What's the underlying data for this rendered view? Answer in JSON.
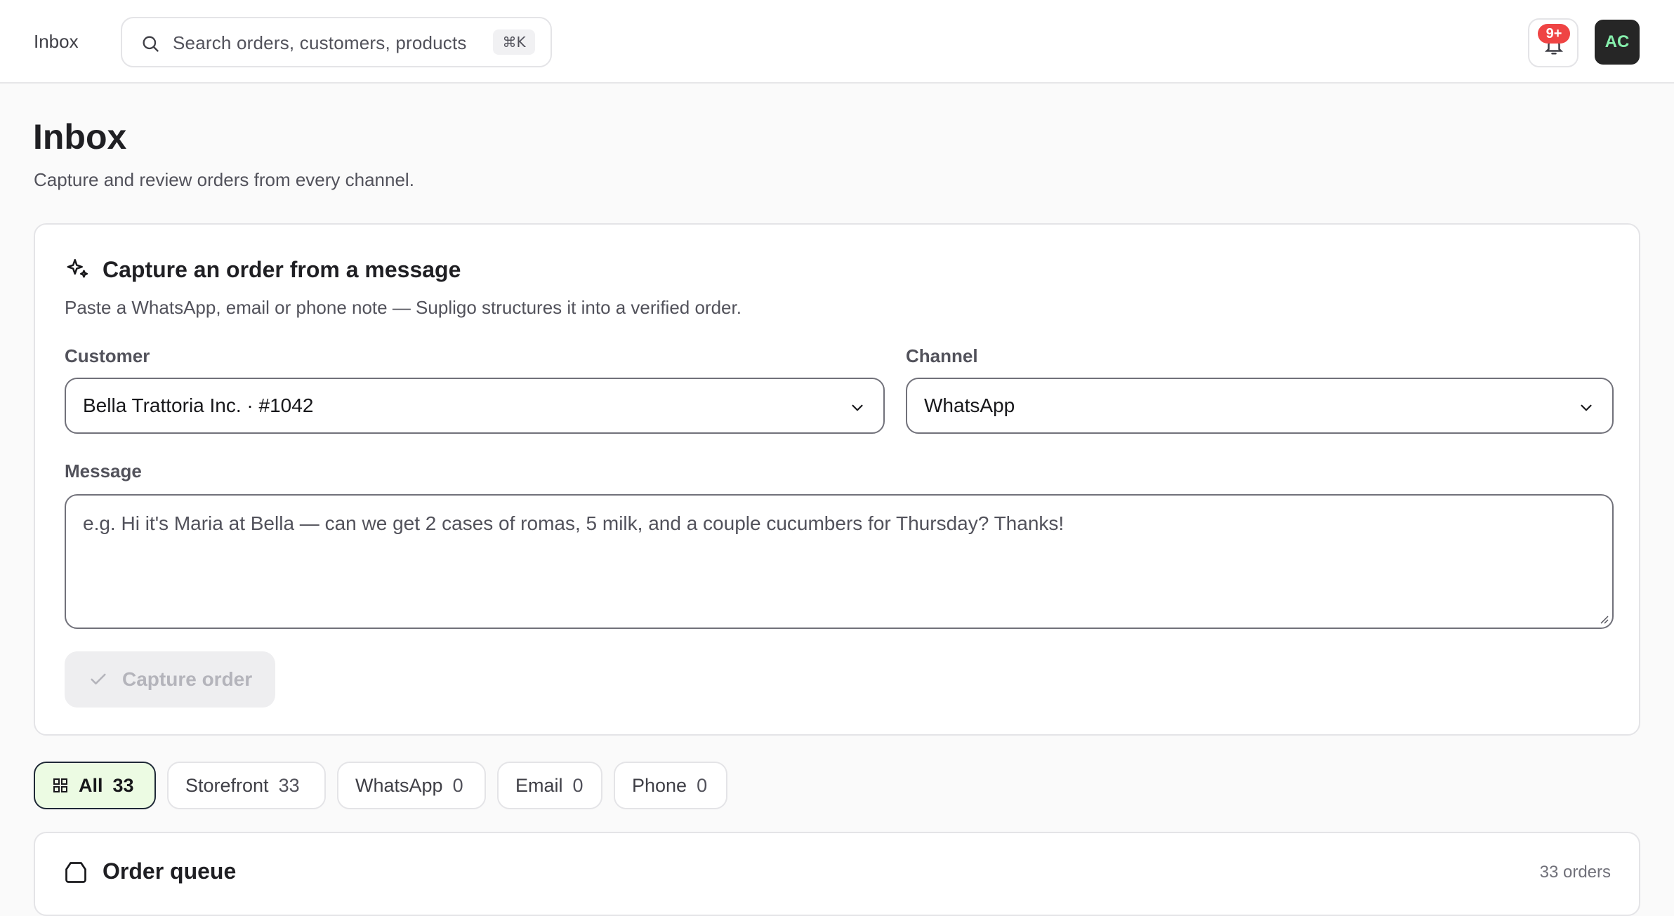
{
  "topbar": {
    "breadcrumb": "Inbox",
    "search_placeholder": "Search orders, customers, products",
    "search_shortcut": "⌘K",
    "notification_badge": "9+",
    "avatar_initials": "AC"
  },
  "page": {
    "title": "Inbox",
    "subtitle": "Capture and review orders from every channel."
  },
  "capture": {
    "title": "Capture an order from a message",
    "description": "Paste a WhatsApp, email or phone note — Supligo structures it into a verified order.",
    "customer_label": "Customer",
    "customer_value": "Bella Trattoria Inc. · #1042",
    "channel_label": "Channel",
    "channel_value": "WhatsApp",
    "message_label": "Message",
    "message_placeholder": "e.g. Hi it's Maria at Bella — can we get 2 cases of romas, 5 milk, and a couple cucumbers for Thursday? Thanks!",
    "submit_label": "Capture order"
  },
  "filters": [
    {
      "label": "All",
      "count": "33"
    },
    {
      "label": "Storefront",
      "count": "33"
    },
    {
      "label": "WhatsApp",
      "count": "0"
    },
    {
      "label": "Email",
      "count": "0"
    },
    {
      "label": "Phone",
      "count": "0"
    }
  ],
  "queue": {
    "title": "Order queue",
    "count_text": "33 orders"
  },
  "colors": {
    "accent_active_bg": "#ecfbe3",
    "badge": "#ef4444",
    "avatar_bg": "#262626",
    "avatar_text": "#86efac"
  }
}
